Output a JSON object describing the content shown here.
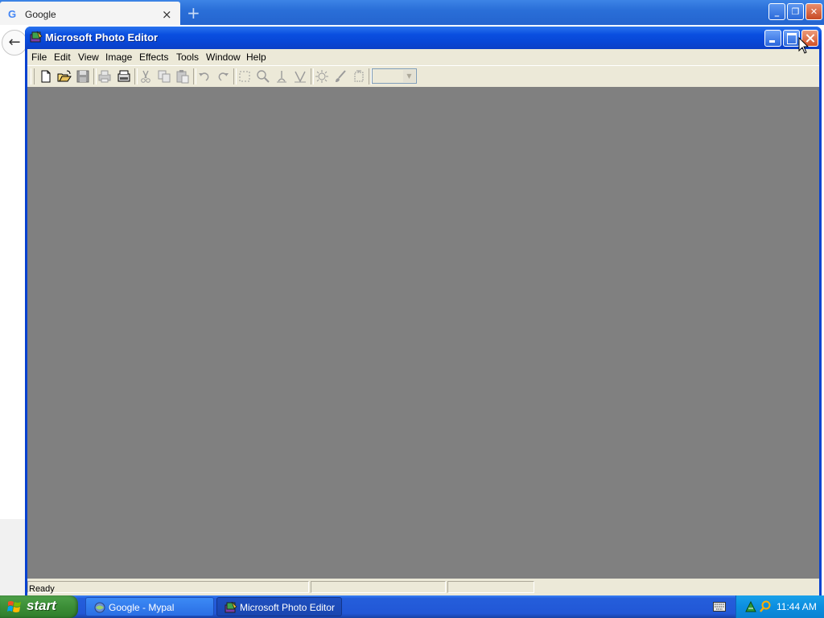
{
  "browser": {
    "tab_title": "Google",
    "tab_favicon": "G",
    "new_tab_icon": "+",
    "tab_close_icon": "×"
  },
  "app": {
    "title": "Microsoft Photo Editor",
    "menu": [
      "File",
      "Edit",
      "View",
      "Image",
      "Effects",
      "Tools",
      "Window",
      "Help"
    ],
    "toolbar": [
      "new-icon",
      "open-icon",
      "save-icon",
      "print-icon",
      "scan-icon",
      "cut-icon",
      "copy-icon",
      "paste-icon",
      "undo-icon",
      "redo-icon",
      "select-icon",
      "zoom-icon",
      "smudge-icon",
      "sharpen-icon",
      "balance-icon",
      "paint-icon",
      "transparent-icon"
    ],
    "zoom_value": "",
    "status": "Ready",
    "workspace_color": "#808080"
  },
  "taskbar": {
    "start_label": "start",
    "tasks": [
      {
        "label": "Google - Mypal",
        "active": false
      },
      {
        "label": "Microsoft Photo Editor",
        "active": true
      }
    ],
    "clock": "11:44 AM"
  },
  "colors": {
    "title_blue": "#0846d6",
    "taskbar_blue": "#245edb",
    "start_green": "#3c8e37",
    "close_red": "#d0512a",
    "tray_blue": "#0c8ee0",
    "dialog_face": "#ece9d8"
  }
}
